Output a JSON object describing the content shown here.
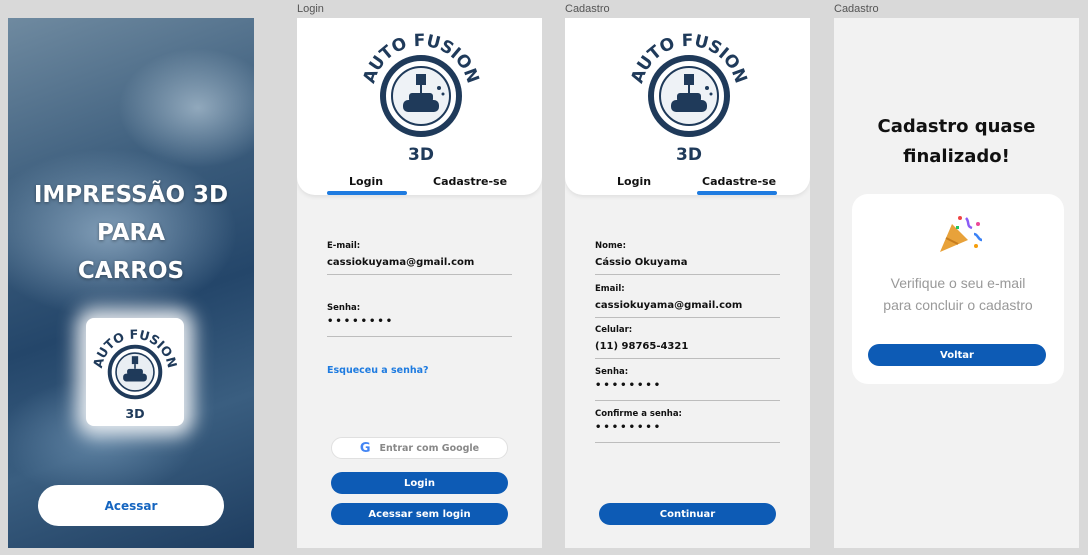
{
  "frame_labels": {
    "login": "Login",
    "cadastro": "Cadastro",
    "final": "Cadastro"
  },
  "splash": {
    "hero_line1": "IMPRESSÃO 3D",
    "hero_line2": "PARA",
    "hero_line3": "CARROS",
    "access_button": "Acessar"
  },
  "logo": {
    "arc_text": "AUTO FUSION",
    "sub_text": "3D"
  },
  "login": {
    "tabs": [
      "Login",
      "Cadastre-se"
    ],
    "active_tab": "Login",
    "email_label": "E-mail:",
    "email_value": "cassiokuyama@gmail.com",
    "password_label": "Senha:",
    "password_value": "••••••••",
    "forgot_link": "Esqueceu a senha?",
    "google_button": "Entrar com Google",
    "login_button": "Login",
    "guest_button": "Acessar sem login"
  },
  "cadastro": {
    "tabs": [
      "Login",
      "Cadastre-se"
    ],
    "active_tab": "Cadastre-se",
    "name_label": "Nome:",
    "name_value": "Cássio Okuyama",
    "email_label": "Email:",
    "email_value": "cassiokuyama@gmail.com",
    "phone_label": "Celular:",
    "phone_value": "(11) 98765-4321",
    "password_label": "Senha:",
    "password_value": "••••••••",
    "confirm_label": "Confirme a senha:",
    "confirm_value": "••••••••",
    "continue_button": "Continuar"
  },
  "final": {
    "title_line1": "Cadastro quase",
    "title_line2": "finalizado!",
    "message_line1": "Verifique o seu e-mail",
    "message_line2": "para concluir o cadastro",
    "back_button": "Voltar",
    "icon": "party-popper-icon"
  },
  "colors": {
    "accent": "#1e7be0",
    "button": "#0d5bb5",
    "logo_dark": "#1f3a5a"
  }
}
